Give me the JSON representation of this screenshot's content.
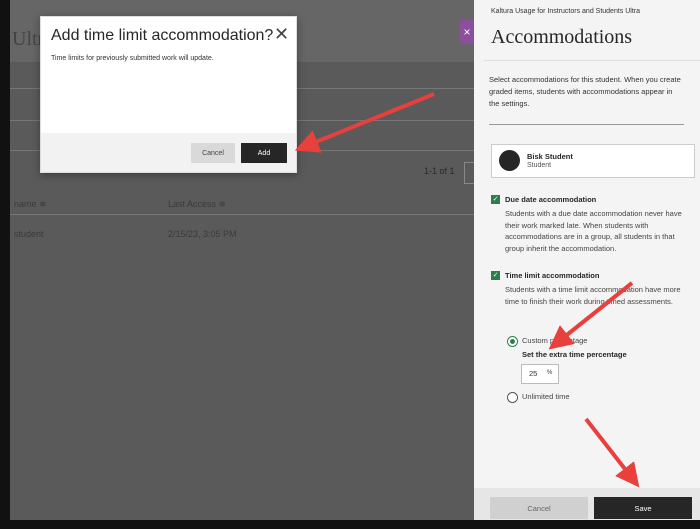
{
  "background": {
    "title_fragment": "Ultr",
    "pager_text": "1-1 of 1",
    "columns": [
      "name ≑",
      "Last Access ≑"
    ],
    "row": [
      "student",
      "2/15/23, 3:05 PM"
    ]
  },
  "dialog": {
    "title": "Add time limit accommodation?",
    "close_symbol": "✕",
    "message": "Time limits for previously submitted work will update.",
    "cancel_label": "Cancel",
    "add_label": "Add"
  },
  "panel": {
    "close_symbol": "×",
    "course_name": "Kaltura Usage for Instructors and Students Ultra",
    "heading": "Accommodations",
    "intro": "Select accommodations for this student. When you create graded items, students with accommodations appear in the settings.",
    "student": {
      "name": "Bisk Student",
      "role": "Student"
    },
    "due_date": {
      "title": "Due date accommodation",
      "checked": true,
      "description": "Students with a due date accommodation never have their work marked late. When students with accommodations are in a group, all students in that group inherit the accommodation."
    },
    "time_limit": {
      "title": "Time limit accommodation",
      "checked": true,
      "description": "Students with a time limit accommodation have more time to finish their work during timed assessments.",
      "custom_label": "Custom percentage",
      "percent_label": "Set the extra time percentage",
      "percent_value": "25",
      "percent_unit": "%",
      "unlimited_label": "Unlimited time",
      "selected": "custom"
    },
    "cancel_label": "Cancel",
    "save_label": "Save"
  },
  "colors": {
    "accent_green": "#2f7d4d",
    "arrow_red": "#e8403c",
    "primary_button": "#262626",
    "purple_tab": "#8b4f9e"
  }
}
